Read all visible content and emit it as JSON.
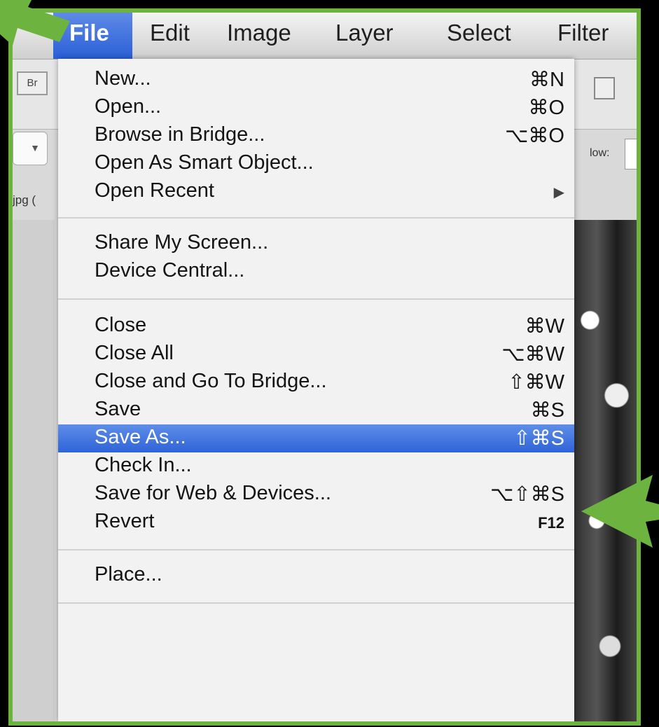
{
  "menubar": {
    "items": [
      "File",
      "Edit",
      "Image",
      "Layer",
      "Select",
      "Filter"
    ]
  },
  "toolbar": {
    "bridge_button": "Br",
    "tab_label": "jpg (",
    "right_label": "low:"
  },
  "file_menu": {
    "items": [
      {
        "label": "New...",
        "shortcut": "⌘N"
      },
      {
        "label": "Open...",
        "shortcut": "⌘O"
      },
      {
        "label": "Browse in Bridge...",
        "shortcut": "⌥⌘O"
      },
      {
        "label": "Open As Smart Object...",
        "shortcut": ""
      },
      {
        "label": "Open Recent",
        "shortcut": "▶"
      },
      {
        "label": "Share My Screen...",
        "shortcut": ""
      },
      {
        "label": "Device Central...",
        "shortcut": ""
      },
      {
        "label": "Close",
        "shortcut": "⌘W"
      },
      {
        "label": "Close All",
        "shortcut": "⌥⌘W"
      },
      {
        "label": "Close and Go To Bridge...",
        "shortcut": "⇧⌘W"
      },
      {
        "label": "Save",
        "shortcut": "⌘S"
      },
      {
        "label": "Save As...",
        "shortcut": "⇧⌘S",
        "highlighted": true
      },
      {
        "label": "Check In...",
        "shortcut": ""
      },
      {
        "label": "Save for Web & Devices...",
        "shortcut": "⌥⇧⌘S"
      },
      {
        "label": "Revert",
        "shortcut": "F12"
      },
      {
        "label": "Place...",
        "shortcut": ""
      }
    ]
  },
  "colors": {
    "frame_border": "#6db33f",
    "highlight": "#2f63d8",
    "annotation_arrow": "#6db33f"
  }
}
